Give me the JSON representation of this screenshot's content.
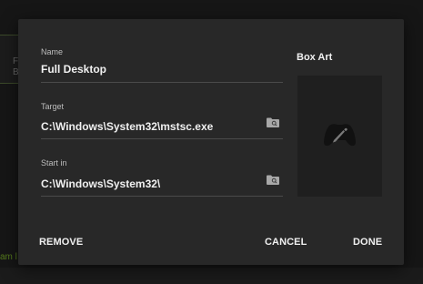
{
  "dialog": {
    "name_field": {
      "label": "Name",
      "value": "Full Desktop"
    },
    "target_field": {
      "label": "Target",
      "value": "C:\\Windows\\System32\\mstsc.exe",
      "browse_icon": "folder-search-icon"
    },
    "start_in_field": {
      "label": "Start in",
      "value": "C:\\Windows\\System32\\",
      "browse_icon": "folder-search-icon"
    },
    "box_art": {
      "title": "Box Art",
      "edit_icon": "gamepad-edit-icon"
    },
    "buttons": {
      "remove": "REMOVE",
      "cancel": "CANCEL",
      "done": "DONE"
    }
  },
  "background": {
    "card_letters": [
      "F",
      "B"
    ],
    "green_text": "am l"
  },
  "colors": {
    "dialog_bg": "#282828",
    "tile_bg": "#1f1f1f",
    "accent_green": "#557a1c"
  }
}
